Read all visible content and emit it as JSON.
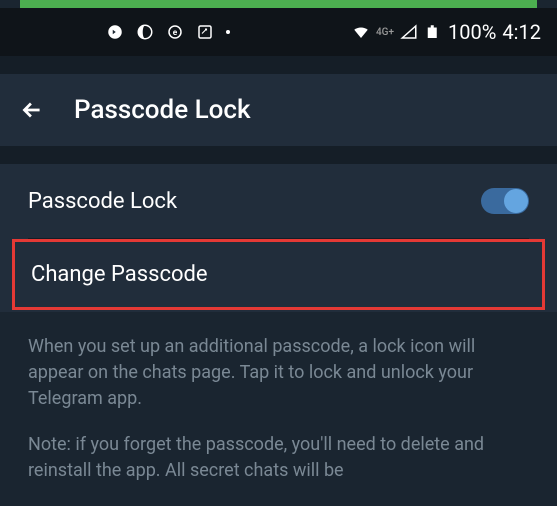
{
  "status_bar": {
    "network_label": "4G+",
    "battery_percent": "100%",
    "time": "4:12"
  },
  "header": {
    "title": "Passcode Lock"
  },
  "settings": {
    "passcode_lock_label": "Passcode Lock",
    "change_passcode_label": "Change Passcode"
  },
  "description": {
    "paragraph1": "When you set up an additional passcode, a lock icon will appear on the chats page. Tap it to lock and unlock your Telegram app.",
    "paragraph2": "Note: if you forget the passcode, you'll need to delete and reinstall the app. All secret chats will be"
  }
}
